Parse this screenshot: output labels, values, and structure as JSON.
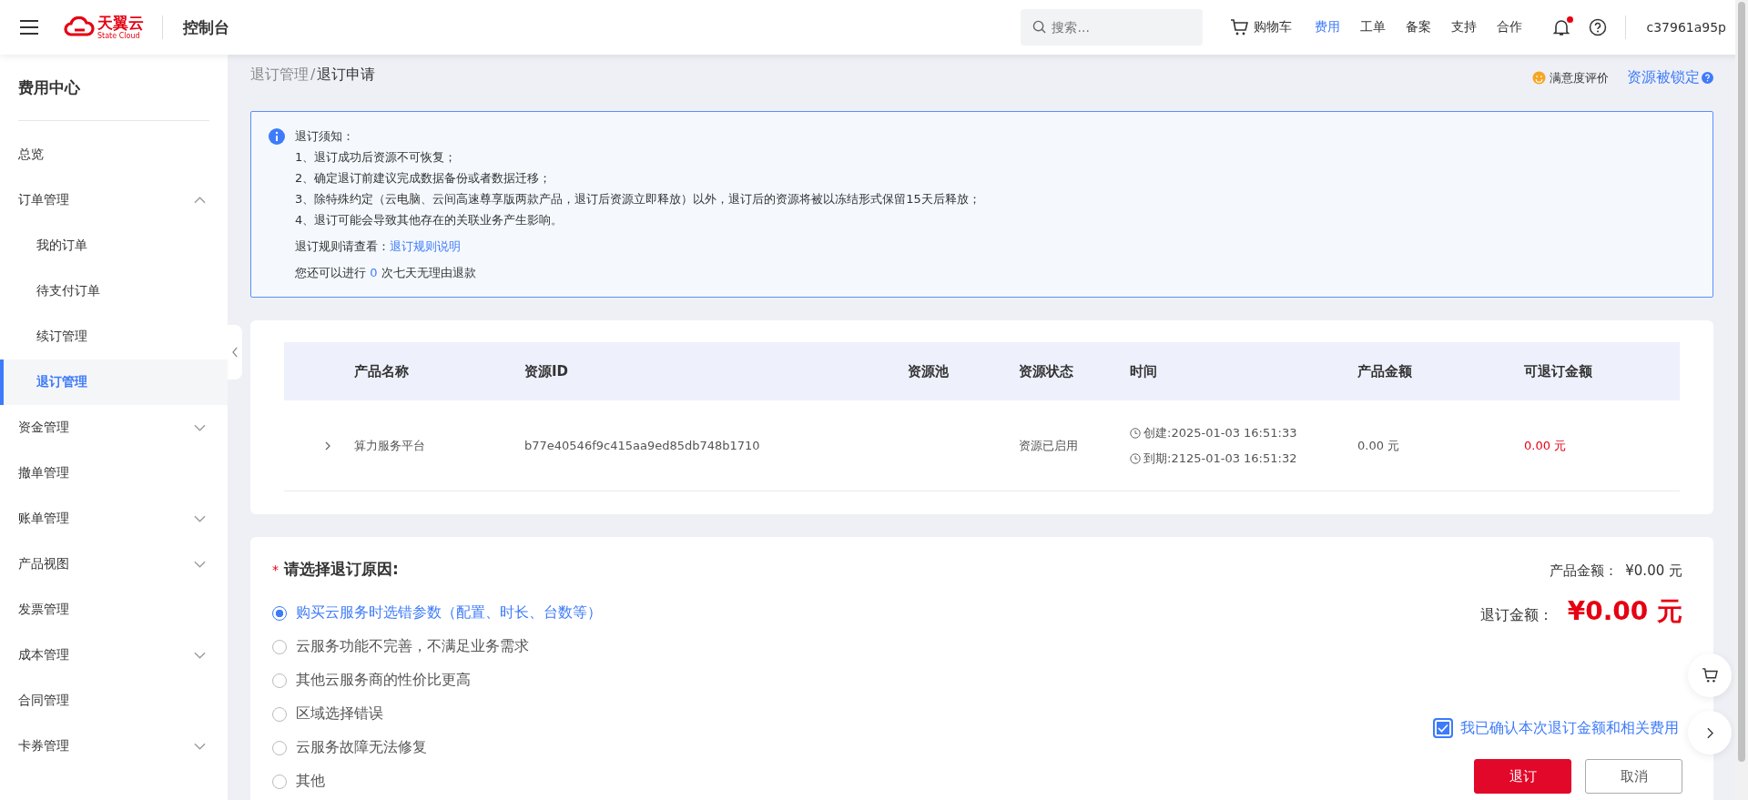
{
  "header": {
    "logo": {
      "name": "天翼云",
      "subtitle": "State Cloud"
    },
    "console_title": "控制台",
    "search": {
      "placeholder": "搜索..."
    },
    "cart_label": "购物车",
    "nav": [
      {
        "label": "费用",
        "selected": true
      },
      {
        "label": "工单",
        "selected": false
      },
      {
        "label": "备案",
        "selected": false
      },
      {
        "label": "支持",
        "selected": false
      },
      {
        "label": "合作",
        "selected": false
      }
    ],
    "notifications_unread": true,
    "user": "c37961a95p"
  },
  "sidebar": {
    "title": "费用中心",
    "items": [
      {
        "label": "总览",
        "selected": false
      },
      {
        "label": "订单管理",
        "selected": false,
        "expanded": true,
        "children": [
          {
            "label": "我的订单",
            "selected": false
          },
          {
            "label": "待支付订单",
            "selected": false
          },
          {
            "label": "续订管理",
            "selected": false
          },
          {
            "label": "退订管理",
            "selected": true
          }
        ]
      },
      {
        "label": "资金管理",
        "selected": false,
        "expanded": false
      },
      {
        "label": "撤单管理",
        "selected": false
      },
      {
        "label": "账单管理",
        "selected": false,
        "expanded": false
      },
      {
        "label": "产品视图",
        "selected": false,
        "expanded": false
      },
      {
        "label": "发票管理",
        "selected": false
      },
      {
        "label": "成本管理",
        "selected": false,
        "expanded": false
      },
      {
        "label": "合同管理",
        "selected": false
      },
      {
        "label": "卡券管理",
        "selected": false,
        "expanded": false
      }
    ]
  },
  "breadcrumb": [
    {
      "label": "退订管理"
    },
    {
      "label": "退订申请"
    }
  ],
  "breadcrumb_separator": "/",
  "top_actions": {
    "rating": "满意度评价",
    "lock_link": "资源被锁定"
  },
  "notice": {
    "title": "退订须知：",
    "items": [
      "1、退订成功后资源不可恢复；",
      "2、确定退订前建议完成数据备份或者数据迁移；",
      "3、除特殊约定（云电脑、云间高速尊享版两款产品，退订后资源立即释放）以外，退订后的资源将被以冻结形式保留15天后释放；",
      "4、退订可能会导致其他存在的关联业务产生影响。"
    ],
    "rules_label": "退订规则请查看：",
    "rules_link": "退订规则说明",
    "remaining_before": "您还可以进行",
    "remaining_count": "0",
    "remaining_after": "次七天无理由退款"
  },
  "table": {
    "columns": [
      "产品名称",
      "资源ID",
      "资源池",
      "资源状态",
      "时间",
      "产品金额",
      "可退订金额"
    ],
    "rows": [
      {
        "expanded": false,
        "product": "算力服务平台",
        "resource_id": "b77e40546f9c415aa9ed85db748b1710",
        "status": "资源已启用",
        "created": "创建:2025-01-03 16:51:33",
        "expires": "到期:2125-01-03 16:51:32",
        "amount": "0.00 元",
        "refundable": "0.00 元"
      }
    ]
  },
  "refund_form": {
    "reason_label": "请选择退订原因:",
    "required_mark": "*",
    "reasons": [
      {
        "label": "购买云服务时选错参数（配置、时长、台数等）",
        "selected": true
      },
      {
        "label": "云服务功能不完善，不满足业务需求",
        "selected": false
      },
      {
        "label": "其他云服务商的性价比更高",
        "selected": false
      },
      {
        "label": "区域选择错误",
        "selected": false
      },
      {
        "label": "云服务故障无法修复",
        "selected": false
      },
      {
        "label": "其他",
        "selected": false
      }
    ],
    "product_amount_label": "产品金额：",
    "product_amount": "¥0.00 元",
    "refund_amount_label": "退订金额：",
    "refund_amount": "¥0.00 元",
    "confirm": {
      "label": "我已确认本次退订金额和相关费用",
      "checked": true
    },
    "buttons": [
      {
        "label": "退订",
        "kind": "primary"
      },
      {
        "label": "取消",
        "kind": "default"
      }
    ]
  }
}
